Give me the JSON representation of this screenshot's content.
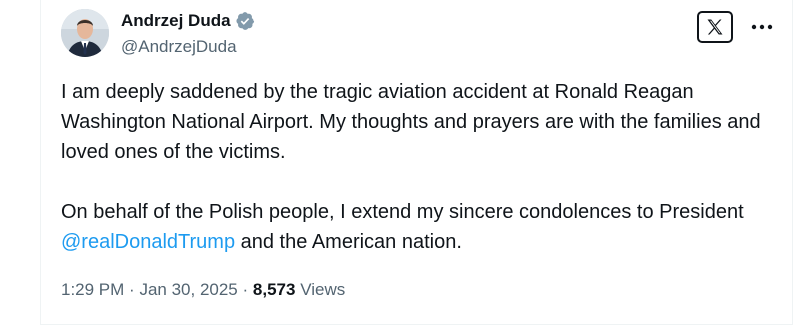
{
  "author": {
    "name": "Andrzej Duda",
    "handle": "@AndrzejDuda",
    "verified": true
  },
  "tweet": {
    "paragraph1": "I am deeply saddened by the tragic aviation accident at Ronald Reagan Washington National Airport. My thoughts and prayers are with the families and loved ones of the victims.",
    "paragraph2_before": "On behalf of the Polish people, I extend my sincere condolences to President ",
    "mention": "@realDonaldTrump",
    "paragraph2_after": " and the American nation."
  },
  "meta": {
    "time": "1:29 PM",
    "separator": "·",
    "date": "Jan 30, 2025",
    "views_count": "8,573",
    "views_label": "Views"
  },
  "colors": {
    "text": "#0f1419",
    "secondary": "#536471",
    "accent": "#1d9bf0"
  },
  "icons": {
    "verified": "verified-badge-icon",
    "logo": "x-logo-icon",
    "more": "more-options-icon"
  }
}
